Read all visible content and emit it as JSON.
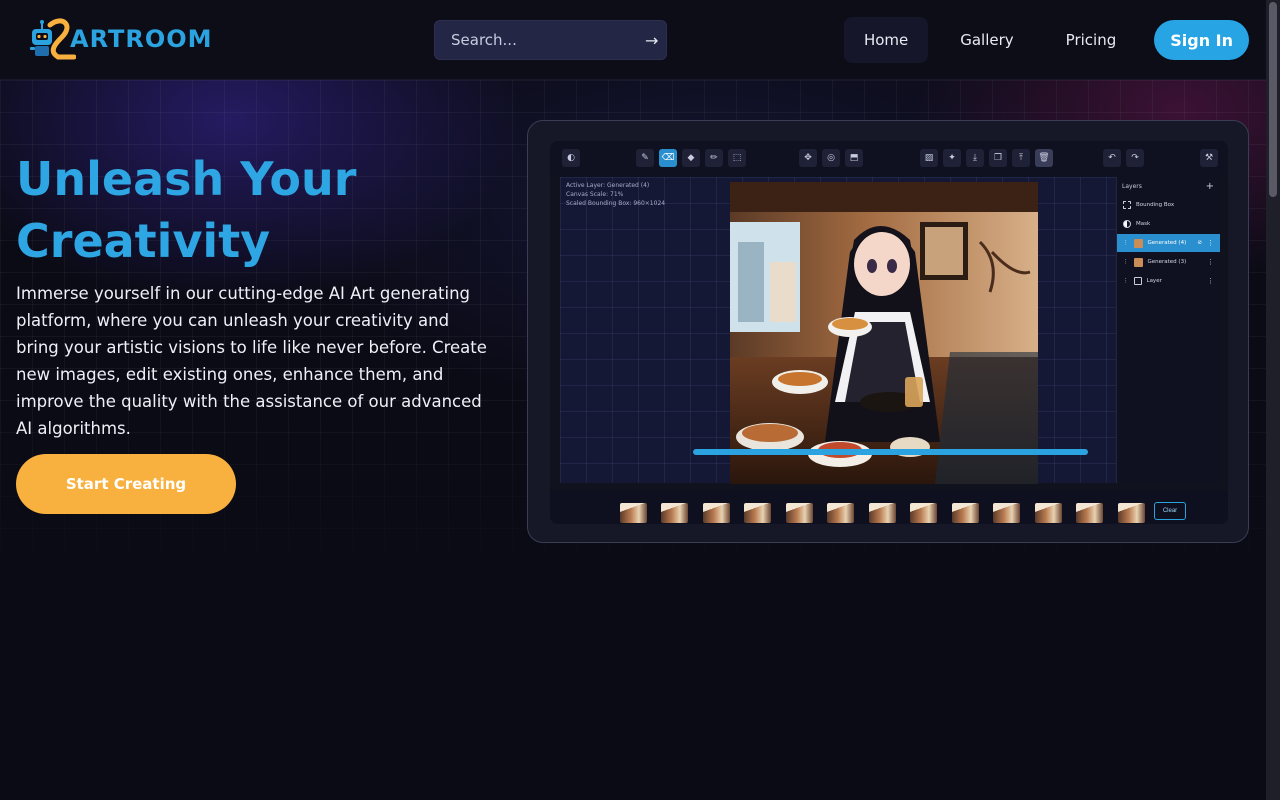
{
  "brand": {
    "name": "ARTROOM"
  },
  "search": {
    "placeholder": "Search..."
  },
  "nav": {
    "items": [
      {
        "label": "Home"
      },
      {
        "label": "Gallery"
      },
      {
        "label": "Pricing"
      }
    ],
    "active": "Home",
    "signin_label": "Sign In"
  },
  "hero": {
    "title_line1": "Unleash Your",
    "title_line2": "Creativity",
    "description": "Immerse yourself in our cutting-edge AI Art generating platform, where you can unleash your creativity and bring your artistic visions to life like never before. Create new images, edit existing ones, enhance them, and improve the quality with the assistance of our advanced AI algorithms.",
    "cta_label": "Start Creating"
  },
  "preview": {
    "canvas_info": {
      "active_layer": "Active Layer: Generated (4)",
      "canvas_scale": "Canvas Scale: 71%",
      "bounding_box": "Scaled Bounding Box: 960×1024"
    },
    "layers_title": "Layers",
    "layers": [
      {
        "name": "Bounding Box",
        "icon": "dashed-box-icon"
      },
      {
        "name": "Mask",
        "icon": "contrast-icon"
      },
      {
        "name": "Generated (4)",
        "icon": "image-thumb-icon",
        "active": true
      },
      {
        "name": "Generated (3)",
        "icon": "image-thumb-icon"
      },
      {
        "name": "Layer",
        "icon": "image-icon"
      }
    ],
    "clear_label": "Clear",
    "progress_fraction": 0.72
  },
  "colors": {
    "accent": "#2aa3e0",
    "cta": "#f8b13e",
    "background": "#0b0b16"
  }
}
